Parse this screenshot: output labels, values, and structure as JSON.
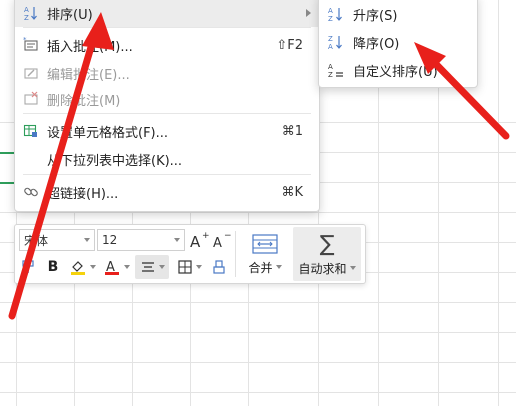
{
  "menu": {
    "items": [
      {
        "label": "排序(U)",
        "shortcut": "",
        "icon": "sort-az-icon",
        "disabled": false,
        "submenu": true
      },
      {
        "label": "插入批注(M)...",
        "shortcut": "⇧F2",
        "icon": "insert-comment-icon",
        "disabled": false
      },
      {
        "label": "编辑批注(E)...",
        "shortcut": "",
        "icon": "edit-comment-icon",
        "disabled": true
      },
      {
        "label": "删除批注(M)",
        "shortcut": "",
        "icon": "delete-comment-icon",
        "disabled": true
      },
      {
        "label": "设置单元格格式(F)...",
        "shortcut": "⌘1",
        "icon": "format-cells-icon",
        "disabled": false
      },
      {
        "label": "从下拉列表中选择(K)...",
        "shortcut": "",
        "icon": "",
        "disabled": false
      },
      {
        "label": "超链接(H)...",
        "shortcut": "⌘K",
        "icon": "hyperlink-icon",
        "disabled": false
      }
    ]
  },
  "submenu": {
    "items": [
      {
        "label": "升序(S)",
        "icon": "sort-ascending-icon"
      },
      {
        "label": "降序(O)",
        "icon": "sort-descending-icon"
      },
      {
        "label": "自定义排序(U)",
        "icon": "custom-sort-icon"
      }
    ]
  },
  "toolbar": {
    "font_name": "宋体",
    "font_size": "12",
    "merge_label": "合并",
    "autosum_label": "自动求和"
  },
  "colors": {
    "accent_red": "#e8201b",
    "grid": "#e3e3e3",
    "selection_green": "#2e9e5b",
    "icon_blue": "#4a79c4"
  }
}
